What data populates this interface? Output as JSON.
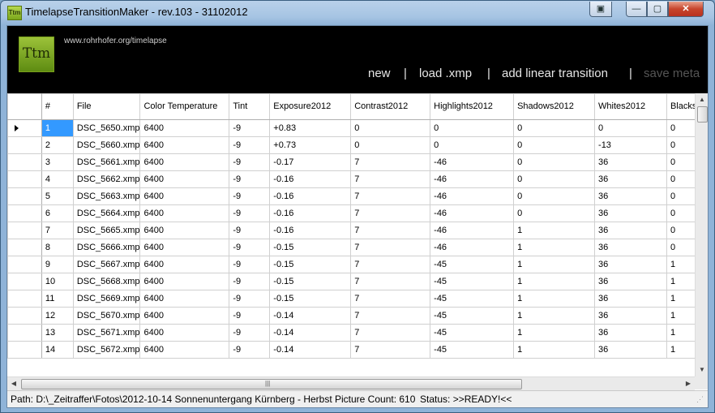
{
  "window": {
    "title": "TimelapseTransitionMaker - rev.103 - 31102012",
    "icon_text": "Ttm",
    "buttons": {
      "extra": "▣",
      "minimize": "—",
      "maximize": "▢",
      "close": "✕"
    }
  },
  "banner": {
    "logo_text": "Ttm",
    "url": "www.rohrhofer.org/timelapse",
    "menu": {
      "new": "new",
      "load": "load .xmp",
      "add_transition": "add linear transition",
      "save_meta": "save meta",
      "separator": "|"
    }
  },
  "grid": {
    "columns": [
      "#",
      "File",
      "Color Temperature",
      "Tint",
      "Exposure2012",
      "Contrast2012",
      "Highlights2012",
      "Shadows2012",
      "Whites2012",
      "Blacks"
    ],
    "rows": [
      [
        "1",
        "DSC_5650.xmp",
        "6400",
        "-9",
        "+0.83",
        "0",
        "0",
        "0",
        "0",
        "0"
      ],
      [
        "2",
        "DSC_5660.xmp",
        "6400",
        "-9",
        "+0.73",
        "0",
        "0",
        "0",
        "-13",
        "0"
      ],
      [
        "3",
        "DSC_5661.xmp",
        "6400",
        "-9",
        "-0.17",
        "7",
        "-46",
        "0",
        "36",
        "0"
      ],
      [
        "4",
        "DSC_5662.xmp",
        "6400",
        "-9",
        "-0.16",
        "7",
        "-46",
        "0",
        "36",
        "0"
      ],
      [
        "5",
        "DSC_5663.xmp",
        "6400",
        "-9",
        "-0.16",
        "7",
        "-46",
        "0",
        "36",
        "0"
      ],
      [
        "6",
        "DSC_5664.xmp",
        "6400",
        "-9",
        "-0.16",
        "7",
        "-46",
        "0",
        "36",
        "0"
      ],
      [
        "7",
        "DSC_5665.xmp",
        "6400",
        "-9",
        "-0.16",
        "7",
        "-46",
        "1",
        "36",
        "0"
      ],
      [
        "8",
        "DSC_5666.xmp",
        "6400",
        "-9",
        "-0.15",
        "7",
        "-46",
        "1",
        "36",
        "0"
      ],
      [
        "9",
        "DSC_5667.xmp",
        "6400",
        "-9",
        "-0.15",
        "7",
        "-45",
        "1",
        "36",
        "1"
      ],
      [
        "10",
        "DSC_5668.xmp",
        "6400",
        "-9",
        "-0.15",
        "7",
        "-45",
        "1",
        "36",
        "1"
      ],
      [
        "11",
        "DSC_5669.xmp",
        "6400",
        "-9",
        "-0.15",
        "7",
        "-45",
        "1",
        "36",
        "1"
      ],
      [
        "12",
        "DSC_5670.xmp",
        "6400",
        "-9",
        "-0.14",
        "7",
        "-45",
        "1",
        "36",
        "1"
      ],
      [
        "13",
        "DSC_5671.xmp",
        "6400",
        "-9",
        "-0.14",
        "7",
        "-45",
        "1",
        "36",
        "1"
      ],
      [
        "14",
        "DSC_5672.xmp",
        "6400",
        "-9",
        "-0.14",
        "7",
        "-45",
        "1",
        "36",
        "1"
      ]
    ],
    "selected_row": 1,
    "hscroll_grip": "|||"
  },
  "status": {
    "path": "Path: D:\\_Zeitraffer\\Fotos\\2012-10-14 Sonnenuntergang Kürnberg - Herbst",
    "count": "Picture Count: 610",
    "state": "Status: >>READY!<<"
  },
  "colors": {
    "selection": "#3399ff",
    "banner": "#000000",
    "logo": "#7aa61b"
  }
}
